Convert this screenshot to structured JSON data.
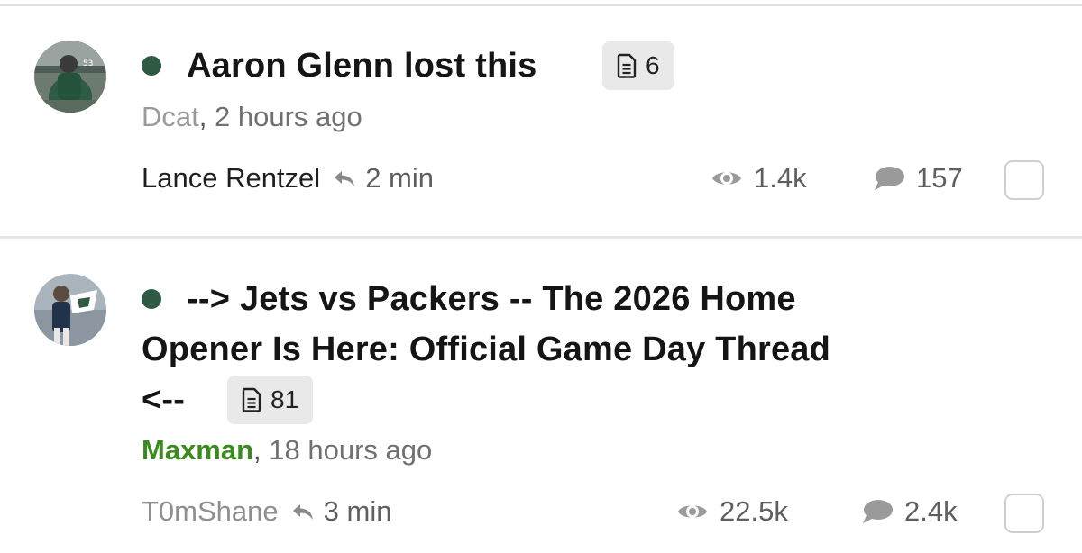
{
  "topics": [
    {
      "title_lines": [
        "Aaron Glenn lost this"
      ],
      "page_count": "6",
      "author": "Dcat",
      "posted_ago": "2 hours ago",
      "last_poster": "Lance Rentzel",
      "last_reply_ago": "2 min",
      "views": "1.4k",
      "replies": "157",
      "avatar_icon": "player-avatar-icon"
    },
    {
      "title_lines": [
        "--> Jets vs Packers -- The 2026 Home",
        "Opener Is Here: Official Game Day Thread",
        "<--"
      ],
      "page_count": "81",
      "author": "Maxman",
      "posted_ago": "18 hours ago",
      "last_poster": "T0mShane",
      "last_reply_ago": "3 min",
      "views": "22.5k",
      "replies": "2.4k",
      "avatar_icon": "fan-avatar-icon"
    }
  ],
  "separator": ",",
  "colors": {
    "unread_dot": "#2f5a43",
    "author_highlight": "#3b8a1e",
    "badge_bg": "#e9e9e9",
    "divider": "#e6e6e6"
  },
  "icons": {
    "document": "document-icon",
    "reply": "reply-arrow-icon",
    "views": "eye-icon",
    "replies": "speech-bubble-icon"
  }
}
